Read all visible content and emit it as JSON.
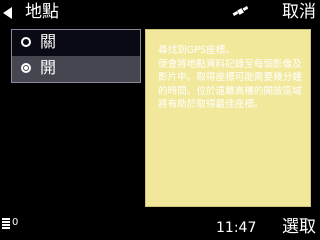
{
  "header": {
    "title": "地點",
    "cancel_label": "取消"
  },
  "options": [
    {
      "label": "關",
      "selected": false
    },
    {
      "label": "開",
      "selected": true
    }
  ],
  "tooltip": {
    "text": "尋找到GPS座標。\n便會將地點資料記錄至每個影像及影片中。取得座標可能需要幾分鐘的時間。位於遠離高樓的開放區域將有助於取得最佳座標。"
  },
  "footer": {
    "status": "0",
    "clock": "11:47",
    "select_label": "選取"
  },
  "colors": {
    "tooltip_bg": "#f1e89c",
    "selected_row": "#454650"
  }
}
